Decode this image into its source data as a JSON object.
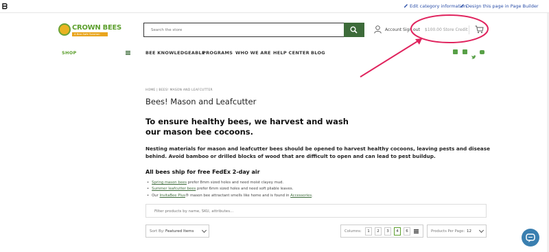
{
  "admin_bar": {
    "edit_category": "Edit category information",
    "page_builder": "Design this page in Page Builder"
  },
  "header": {
    "logo_text": "CROWN BEES",
    "logo_tagline": "A Bee-Safe Solution",
    "search_placeholder": "Search the store",
    "account": "Account",
    "sign_out": "Sign out",
    "store_credit": "$100.00 Store Credit"
  },
  "nav": {
    "shop": "SHOP",
    "items": [
      "BEE KNOWLEDGEABLE",
      "PROGRAMS",
      "WHO WE ARE",
      "HELP CENTER",
      "BLOG"
    ]
  },
  "breadcrumb": "HOME  |  BEES! MASON AND LEAFCUTTER",
  "page_title": "Bees! Mason and Leafcutter",
  "headline": "To ensure healthy bees, we harvest and wash our mason bee cocoons.",
  "intro": "Nesting materials for mason and leafcutter bees should be opened to harvest healthy cocoons, leaving pests and disease behind. Avoid bamboo or drilled blocks of wood that are difficult to open and can lead to pest buildup.",
  "shipping_heading": "All bees ship for free FedEx 2-day air",
  "bullets": [
    {
      "link": "Spring mason bees",
      "text": " prefer 8mm sized holes and need moist clayey mud."
    },
    {
      "link": "Summer leafcutter bees",
      "text": " prefer 6mm sized holes and need soft pliable leaves."
    },
    {
      "pre": "Our ",
      "link": "InvitaBee Plus",
      "text": "® mason bee attractant smells like home and is found in ",
      "link2": "Accessories",
      "post": "."
    }
  ],
  "filter_placeholder": "Filter products by name, SKU, attributes...",
  "sort": {
    "label": "Sort By:",
    "value": "Featured Items"
  },
  "columns": {
    "label": "Columns:",
    "options": [
      "1",
      "2",
      "3",
      "4",
      "6"
    ],
    "selected": "4"
  },
  "per_page": {
    "label": "Products Per Page:",
    "value": "12"
  },
  "colors": {
    "brand_green": "#5c9f2d",
    "dark_green": "#3d6b3a",
    "annotation_red": "#e0245e"
  }
}
